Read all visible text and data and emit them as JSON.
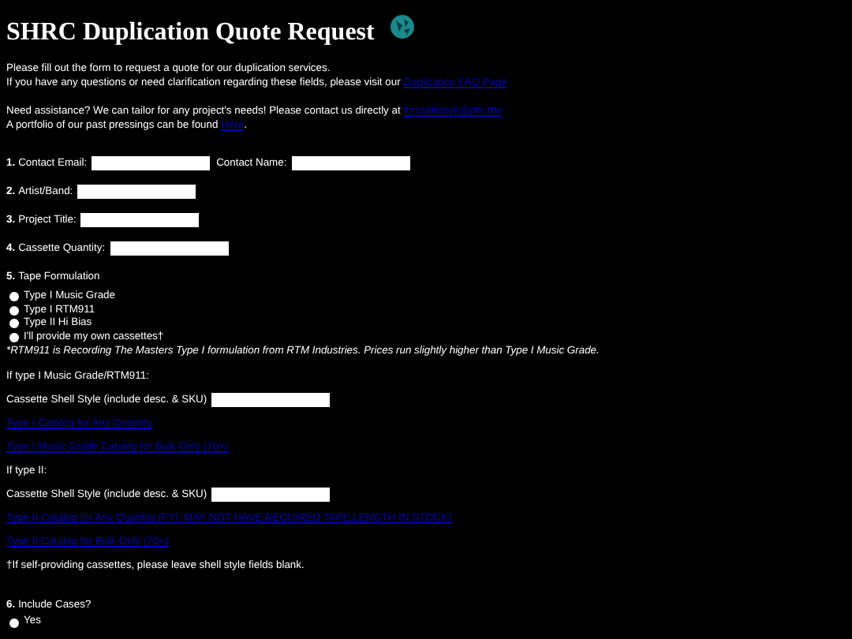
{
  "title": "SHRC Duplication Quote Request",
  "intro": [
    [
      {
        "text": "Please fill out the form to request a quote for our duplication services."
      },
      {
        "text": "If you have any questions or need clarification regarding these fields, please visit our ",
        "link": "Duplication FAQ Page"
      }
    ],
    [
      {
        "text": "Need assistance? We can tailor for any project's needs! Please contact us directly at ",
        "link": "thrcollective@pm.me"
      },
      {
        "text": "A portfolio of our past pressings can be found ",
        "link": "Here",
        "after": "."
      }
    ]
  ],
  "questions": [
    {
      "kind": "fields",
      "number": "1.",
      "fields": [
        "Contact Email:",
        "Contact Name:"
      ]
    },
    {
      "kind": "fields",
      "number": "2.",
      "fields": [
        "Artist/Band:"
      ]
    },
    {
      "kind": "fields",
      "number": "3.",
      "fields": [
        "Project Title:"
      ]
    },
    {
      "kind": "fields",
      "number": "4.",
      "fields": [
        "Cassette Quantity:"
      ]
    },
    {
      "kind": "choice",
      "number": "5.",
      "label": "Tape Formulation",
      "options": [
        {
          "label": "Type I Music Grade",
          "selected": false
        },
        {
          "label": "Type I RTM911",
          "selected": false
        },
        {
          "label": "Type II Hi Bias",
          "selected": false
        },
        {
          "label": "I'll provide my own cassettes†",
          "selected": false
        }
      ],
      "note": "*RTM911 is Recording The Masters Type I formulation from RTM Industries. Prices run slightly higher than Type I Music Grade."
    }
  ],
  "sections": [
    {
      "heading": "If type I Music Grade/RTM911:",
      "field": "Cassette Shell Style (include desc. & SKU)",
      "links": [
        "Type I Catalog for Any Quantity",
        "Type I Music Grade Catalog for Bulk Only (70+)"
      ]
    },
    {
      "heading": "If type II:",
      "field": "Cassette Shell Style (include desc. & SKU)",
      "links": [
        "Type II Catalog for Any Quantity (FYI, MAY NOT HAVE REQUIRED TAPE LENGTH IN STOCK)",
        "Type II Catalog for Bulk Only (70+)"
      ]
    }
  ],
  "footnote": "†If self-providing cassettes, please leave shell style fields blank.",
  "final": {
    "number": "6.",
    "label": "Include Cases?",
    "options": [
      {
        "label": "Yes",
        "selected": false
      }
    ]
  }
}
